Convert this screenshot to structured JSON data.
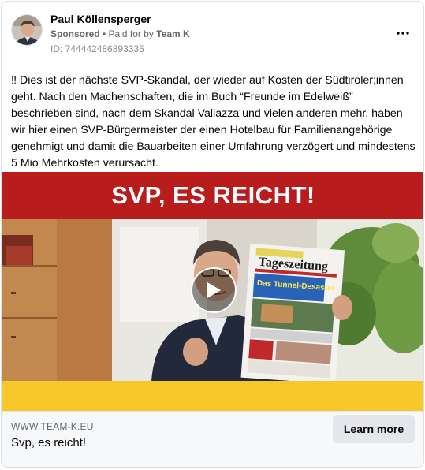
{
  "header": {
    "page_name": "Paul Köllensperger",
    "sponsored": "Sponsored",
    "separator": " • ",
    "paid_for_prefix": "Paid for by ",
    "paid_for_name": "Team K",
    "ad_id": "ID: 744442486893335",
    "more_icon": "more-horizontal-icon"
  },
  "post": {
    "text": "‼ Dies ist der nächste SVP-Skandal, der wieder auf Kosten der Südtiroler;innen geht. Nach den Machenschaften, die im Buch “Freunde im Edelweiß” beschrieben sind, nach dem Skandal Vallazza und vielen anderen mehr, haben wir hier einen SVP-Bürgermeister der einen Hotelbau für Familienangehörige genehmigt und damit die Bauarbeiten einer Umfahrung verzögert und mindestens 5 Mio Mehrkosten verursacht."
  },
  "media": {
    "banner_text": "SVP, ES REICHT!",
    "newspaper_masthead": "Tageszeitung",
    "newspaper_headline": "Das Tunnel-Desaster",
    "play_icon": "play-icon",
    "colors": {
      "banner": "#b91c1c",
      "strip": "#f6c829"
    }
  },
  "footer": {
    "domain": "WWW.TEAM-K.EU",
    "headline": "Svp, es reicht!",
    "cta_label": "Learn more"
  }
}
